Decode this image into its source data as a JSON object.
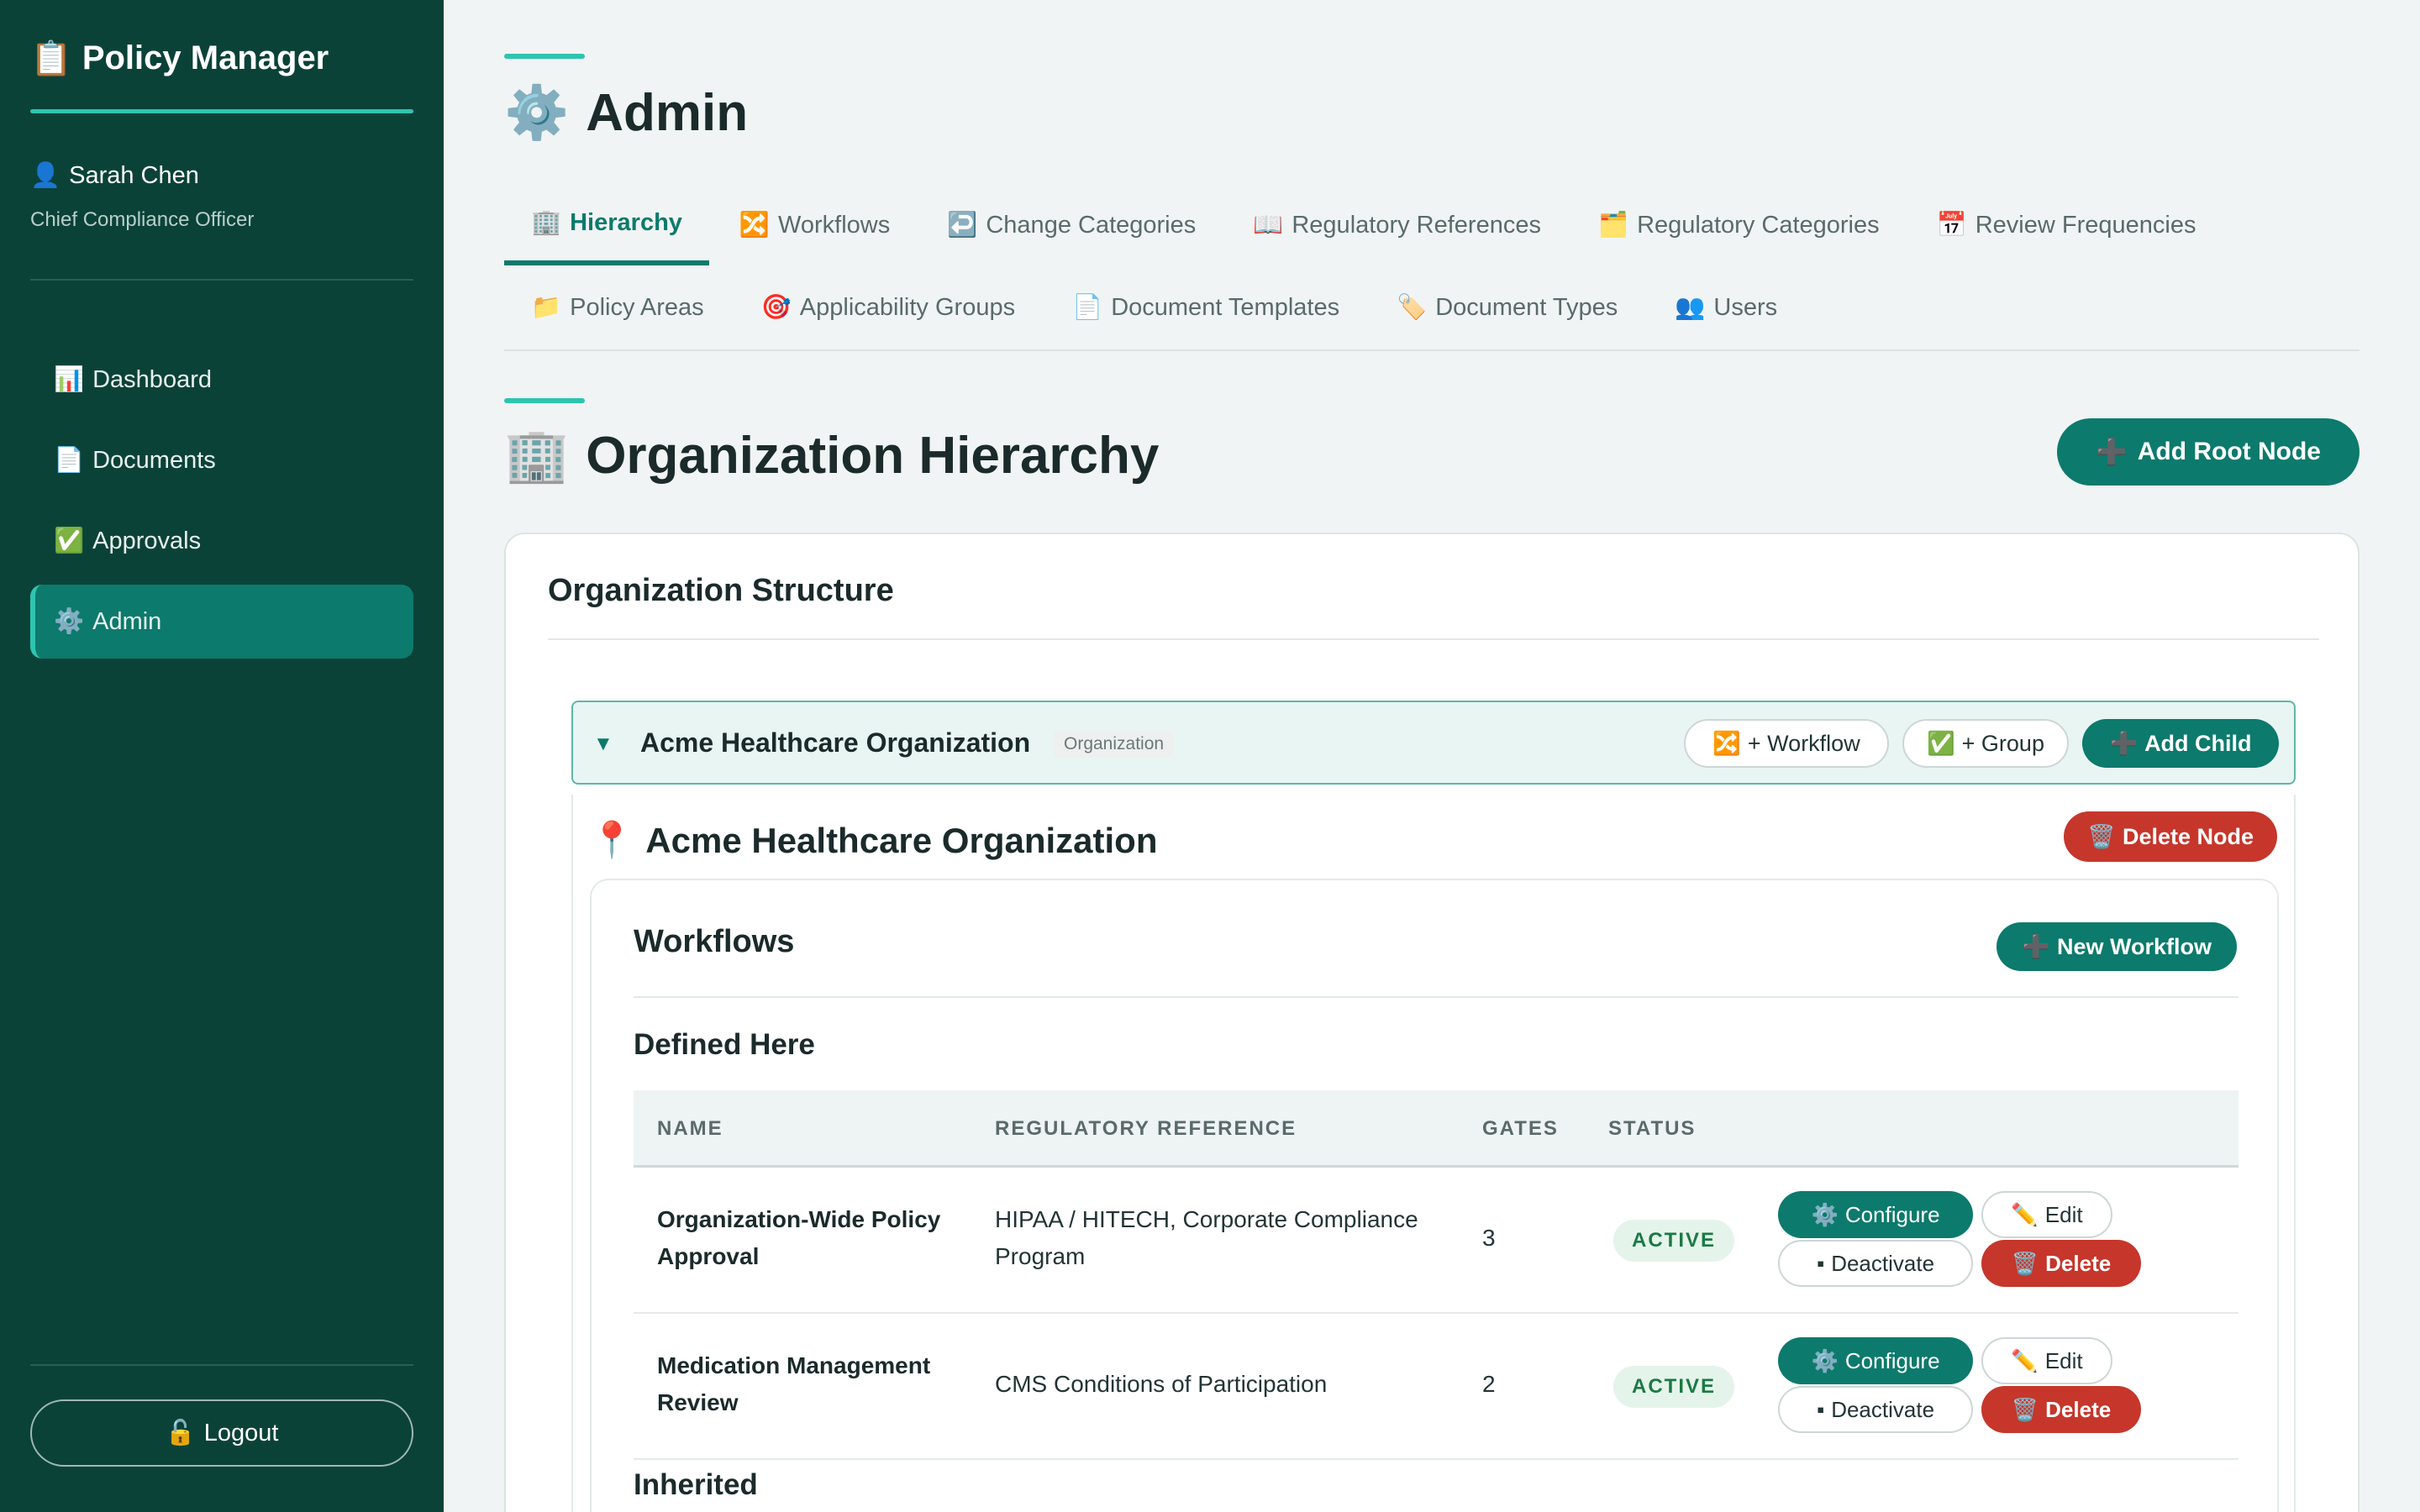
{
  "sidebar": {
    "brand": {
      "icon": "📋",
      "title": "Policy Manager"
    },
    "user": {
      "icon": "👤",
      "name": "Sarah Chen",
      "role": "Chief Compliance Officer"
    },
    "nav": [
      {
        "icon": "📊",
        "label": "Dashboard",
        "active": false
      },
      {
        "icon": "📄",
        "label": "Documents",
        "active": false
      },
      {
        "icon": "✅",
        "label": "Approvals",
        "active": false
      },
      {
        "icon": "⚙️",
        "label": "Admin",
        "active": true
      }
    ],
    "logout": {
      "icon": "🔓",
      "label": "Logout"
    }
  },
  "page": {
    "icon": "⚙️",
    "title": "Admin"
  },
  "tabs": {
    "row1": [
      {
        "icon": "🏢",
        "label": "Hierarchy",
        "active": true
      },
      {
        "icon": "🔀",
        "label": "Workflows"
      },
      {
        "icon": "↩️",
        "label": "Change Categories"
      },
      {
        "icon": "📖",
        "label": "Regulatory References"
      },
      {
        "icon": "🗂️",
        "label": "Regulatory Categories"
      },
      {
        "icon": "📅",
        "label": "Review Frequencies"
      }
    ],
    "row2": [
      {
        "icon": "📁",
        "label": "Policy Areas"
      },
      {
        "icon": "🎯",
        "label": "Applicability Groups"
      },
      {
        "icon": "📄",
        "label": "Document Templates"
      },
      {
        "icon": "🏷️",
        "label": "Document Types"
      },
      {
        "icon": "👥",
        "label": "Users"
      }
    ]
  },
  "section": {
    "icon": "🏢",
    "title": "Organization Hierarchy",
    "add_root_icon": "➕",
    "add_root_label": "Add Root Node"
  },
  "structure": {
    "title": "Organization Structure",
    "node": {
      "caret": "▼",
      "name": "Acme Healthcare Organization",
      "type": "Organization",
      "workflow_btn_icon": "🔀",
      "workflow_btn": "+ Workflow",
      "group_btn_icon": "✅",
      "group_btn": "+ Group",
      "add_child_icon": "➕",
      "add_child": "Add Child"
    },
    "detail": {
      "pin_icon": "📍",
      "name": "Acme Healthcare Organization",
      "delete_icon": "🗑️",
      "delete_label": "Delete Node"
    }
  },
  "workflows": {
    "title": "Workflows",
    "new_icon": "➕",
    "new_label": "New Workflow",
    "defined_here": "Defined Here",
    "inherited": "Inherited",
    "columns": [
      "NAME",
      "REGULATORY REFERENCE",
      "GATES",
      "STATUS"
    ],
    "rows": [
      {
        "name": "Organization-Wide Policy Approval",
        "ref": "HIPAA / HITECH, Corporate Compliance Program",
        "gates": "3",
        "status": "ACTIVE"
      },
      {
        "name": "Medication Management Review",
        "ref": "CMS Conditions of Participation",
        "gates": "2",
        "status": "ACTIVE"
      }
    ],
    "actions": {
      "configure_icon": "⚙️",
      "configure": "Configure",
      "edit_icon": "✏️",
      "edit": "Edit",
      "deactivate_icon": "▪",
      "deactivate": "Deactivate",
      "delete_icon": "🗑️",
      "delete": "Delete"
    }
  },
  "colors": {
    "sidebar": "#0b4238",
    "accent": "#2ec4b0",
    "primary": "#0c7a6c",
    "danger": "#c6362b"
  }
}
